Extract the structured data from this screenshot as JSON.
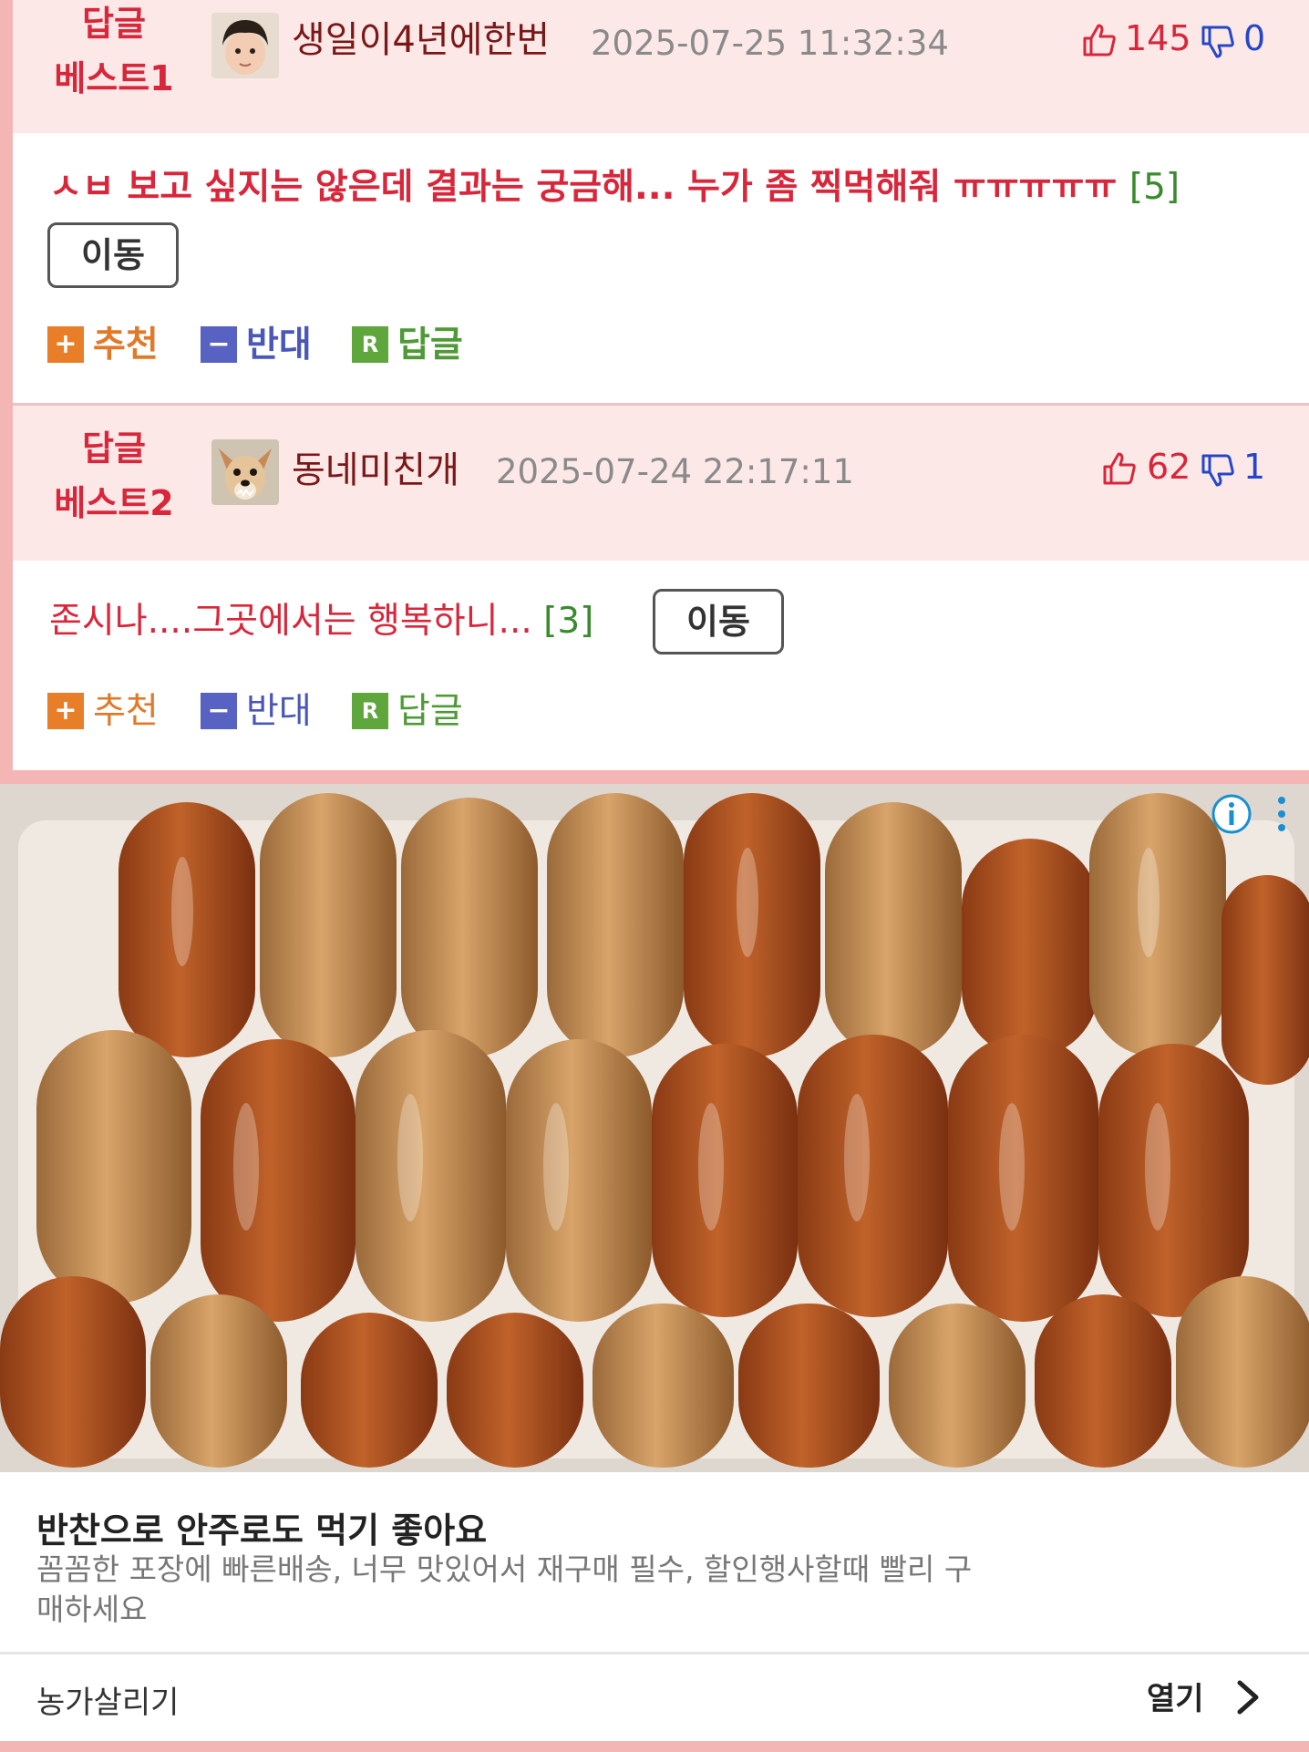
{
  "comments": [
    {
      "best_label_line1": "답글",
      "best_label_line2": "베스트1",
      "username": "생일이4년에한번",
      "date": "2025-07-25 11:32:34",
      "upvotes": "145",
      "downvotes": "0",
      "text": "ㅅㅂ 보고 싶지는 않은데 결과는 궁금해... 누가 좀 찍먹해줘 ㅠㅠㅠㅠㅠ",
      "reply_count": "[5]",
      "move_label": "이동",
      "actions": {
        "up": "추천",
        "down": "반대",
        "reply": "답글"
      }
    },
    {
      "best_label_line1": "답글",
      "best_label_line2": "베스트2",
      "username": "동네미친개",
      "date": "2025-07-24 22:17:11",
      "upvotes": "62",
      "downvotes": "1",
      "text": "존시나....그곳에서는 행복하니...",
      "reply_count": "[3]",
      "move_label": "이동",
      "actions": {
        "up": "추천",
        "down": "반대",
        "reply": "답글"
      }
    }
  ],
  "ad": {
    "title": "반찬으로 안주로도 먹기 좋아요",
    "description": "꼼꼼한 포장에 빠른배송, 너무 맛있어서 재구매 필수, 할인행사할때 빨리 구매하세요",
    "brand": "농가살리기",
    "open_label": "열기"
  },
  "colors": {
    "page_background": "#f4b5b5",
    "header_background": "#fde8e8",
    "accent_red": "#d8263a",
    "downvote_blue": "#2447c9",
    "reply_count_green": "#3a8a2e"
  },
  "icons": [
    "thumbs-up-icon",
    "thumbs-down-icon",
    "plus-icon",
    "minus-icon",
    "reply-icon",
    "info-icon",
    "more-icon",
    "chevron-right-icon"
  ]
}
